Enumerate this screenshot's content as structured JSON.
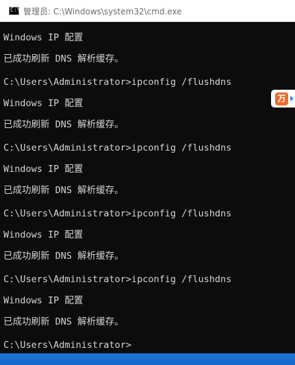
{
  "window": {
    "title": "管理员: C:\\Windows\\system32\\cmd.exe",
    "icon": "cmd-icon"
  },
  "console": {
    "lines": [
      "Windows IP 配置",
      "已成功刷新 DNS 解析缓存。",
      "C:\\Users\\Administrator>ipconfig /flushdns",
      "Windows IP 配置",
      "已成功刷新 DNS 解析缓存。",
      "C:\\Users\\Administrator>ipconfig /flushdns",
      "Windows IP 配置",
      "已成功刷新 DNS 解析缓存。",
      "C:\\Users\\Administrator>ipconfig /flushdns",
      "Windows IP 配置",
      "已成功刷新 DNS 解析缓存。",
      "C:\\Users\\Administrator>ipconfig /flushdns",
      "Windows IP 配置",
      "已成功刷新 DNS 解析缓存。",
      "C:\\Users\\Administrator>"
    ]
  },
  "side_widget": {
    "icon": "app-logo-icon",
    "logo_text": "万",
    "accent_color": "#f06a28"
  },
  "colors": {
    "console_bg": "#0c0c0c",
    "console_text": "#d4d4d4",
    "titlebar_bg": "#ffffff",
    "desktop_blue": "#1565c8"
  }
}
